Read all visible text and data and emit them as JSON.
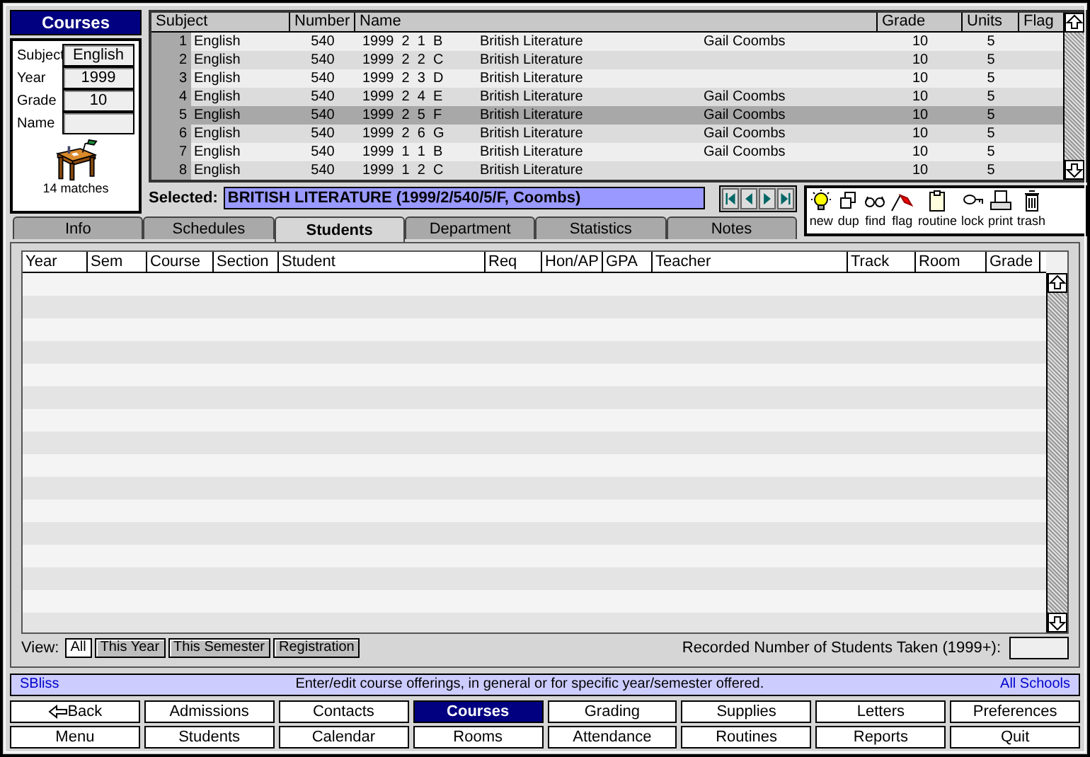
{
  "sidebar": {
    "title": "Courses",
    "fields": [
      {
        "label": "Subject",
        "value": "English"
      },
      {
        "label": "Year",
        "value": "1999"
      },
      {
        "label": "Grade",
        "value": "10"
      },
      {
        "label": "Name"
      }
    ],
    "matches": "14 matches"
  },
  "courses": {
    "columns": [
      "Subject",
      "Number",
      "Name",
      "Grade",
      "Units",
      "Flag"
    ],
    "rows": [
      {
        "num": "1",
        "subject": "English",
        "number": "540",
        "name_1": "1999  2  1  B",
        "name_2": "British Literature",
        "name_3": "Gail Coombs",
        "grade": "10",
        "units": "5",
        "selected": false
      },
      {
        "num": "2",
        "subject": "English",
        "number": "540",
        "name_1": "1999  2  2  C",
        "name_2": "British Literature",
        "name_3": "",
        "grade": "10",
        "units": "5",
        "selected": false
      },
      {
        "num": "3",
        "subject": "English",
        "number": "540",
        "name_1": "1999  2  3  D",
        "name_2": "British Literature",
        "name_3": "",
        "grade": "10",
        "units": "5",
        "selected": false
      },
      {
        "num": "4",
        "subject": "English",
        "number": "540",
        "name_1": "1999  2  4  E",
        "name_2": "British Literature",
        "name_3": "Gail Coombs",
        "grade": "10",
        "units": "5",
        "selected": false
      },
      {
        "num": "5",
        "subject": "English",
        "number": "540",
        "name_1": "1999  2  5  F",
        "name_2": "British Literature",
        "name_3": "Gail Coombs",
        "grade": "10",
        "units": "5",
        "selected": true
      },
      {
        "num": "6",
        "subject": "English",
        "number": "540",
        "name_1": "1999  2  6  G",
        "name_2": "British Literature",
        "name_3": "Gail Coombs",
        "grade": "10",
        "units": "5",
        "selected": false
      },
      {
        "num": "7",
        "subject": "English",
        "number": "540",
        "name_1": "1999  1  1  B",
        "name_2": "British Literature",
        "name_3": "Gail Coombs",
        "grade": "10",
        "units": "5",
        "selected": false
      },
      {
        "num": "8",
        "subject": "English",
        "number": "540",
        "name_1": "1999  1  2  C",
        "name_2": "British Literature",
        "name_3": "",
        "grade": "10",
        "units": "5",
        "selected": false
      }
    ]
  },
  "selected": {
    "label": "Selected:",
    "value": "BRITISH LITERATURE (1999/2/540/5/F, Coombs)"
  },
  "toolbar": [
    {
      "kind": "new",
      "label": "new"
    },
    {
      "kind": "dup",
      "label": "dup"
    },
    {
      "kind": "find",
      "label": "find"
    },
    {
      "kind": "flag",
      "label": "flag"
    },
    {
      "kind": "routine",
      "label": "routine"
    },
    {
      "kind": "lock",
      "label": "lock"
    },
    {
      "kind": "print",
      "label": "print"
    },
    {
      "kind": "trash",
      "label": "trash"
    }
  ],
  "tabs": [
    {
      "label": "Info",
      "selected": false
    },
    {
      "label": "Schedules",
      "selected": false
    },
    {
      "label": "Students",
      "selected": true
    },
    {
      "label": "Department",
      "selected": false
    },
    {
      "label": "Statistics",
      "selected": false
    },
    {
      "label": "Notes",
      "selected": false
    }
  ],
  "students": {
    "columns": [
      "Year",
      "Sem",
      "Course",
      "Section",
      "Student",
      "Req",
      "Hon/AP",
      "GPA",
      "Teacher",
      "Track",
      "Room",
      "Grade"
    ]
  },
  "view": {
    "label": "View:",
    "buttons": [
      {
        "label": "All",
        "selected": true
      },
      {
        "label": "This Year",
        "selected": false
      },
      {
        "label": "This Semester",
        "selected": false
      },
      {
        "label": "Registration",
        "selected": false
      }
    ],
    "recorded_label": "Recorded Number of Students Taken (1999+):"
  },
  "status_bar": {
    "user": "SBliss",
    "message": "Enter/edit course offerings, in general or for specific year/semester offered.",
    "scope": "All Schools"
  },
  "nav": [
    {
      "label": "Back",
      "kind": "back",
      "selected": false
    },
    {
      "label": "Admissions",
      "selected": false
    },
    {
      "label": "Contacts",
      "selected": false
    },
    {
      "label": "Courses",
      "selected": true
    },
    {
      "label": "Grading",
      "selected": false
    },
    {
      "label": "Supplies",
      "selected": false
    },
    {
      "label": "Letters",
      "selected": false
    },
    {
      "label": "Preferences",
      "selected": false
    },
    {
      "label": "Menu",
      "selected": false
    },
    {
      "label": "Students",
      "selected": false
    },
    {
      "label": "Calendar",
      "selected": false
    },
    {
      "label": "Rooms",
      "selected": false
    },
    {
      "label": "Attendance",
      "selected": false
    },
    {
      "label": "Routines",
      "selected": false
    },
    {
      "label": "Reports",
      "selected": false
    },
    {
      "label": "Quit",
      "selected": false
    }
  ]
}
